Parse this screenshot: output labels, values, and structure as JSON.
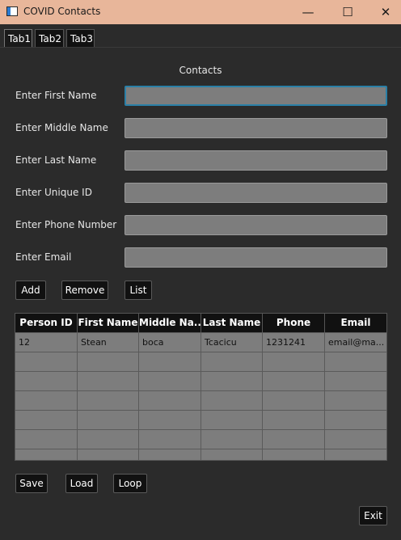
{
  "window": {
    "title": "COVID Contacts",
    "minimize": "—",
    "maximize": "☐",
    "close": "✕"
  },
  "tabs": [
    {
      "label": "Tab1"
    },
    {
      "label": "Tab2"
    },
    {
      "label": "Tab3"
    }
  ],
  "form": {
    "title": "Contacts",
    "fields": [
      {
        "label": "Enter First Name",
        "value": ""
      },
      {
        "label": "Enter Middle Name",
        "value": ""
      },
      {
        "label": "Enter Last Name",
        "value": ""
      },
      {
        "label": "Enter Unique ID",
        "value": ""
      },
      {
        "label": "Enter Phone Number",
        "value": ""
      },
      {
        "label": "Enter Email",
        "value": ""
      }
    ]
  },
  "actions": {
    "add": "Add",
    "remove": "Remove",
    "list": "List"
  },
  "table": {
    "columns": [
      "Person ID",
      "First Name",
      "Middle Na...",
      "Last Name",
      "Phone",
      "Email"
    ],
    "rows": [
      [
        "12",
        "Stean",
        "boca",
        "Tcacicu",
        "1231241",
        "email@ma..."
      ]
    ]
  },
  "footer": {
    "save": "Save",
    "load": "Load",
    "loop": "Loop",
    "exit": "Exit"
  }
}
